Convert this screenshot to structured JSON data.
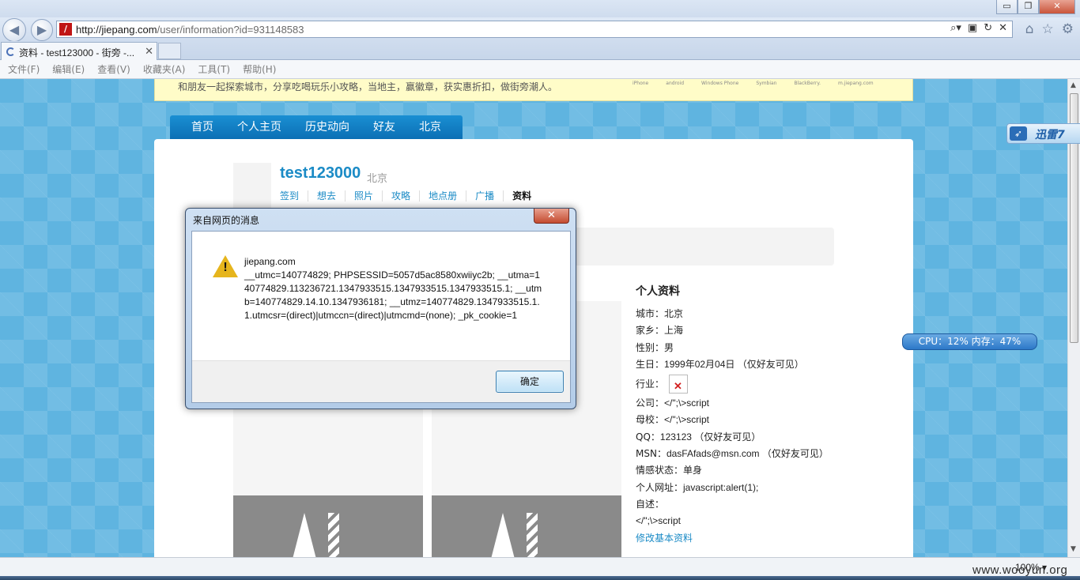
{
  "browser": {
    "url_host": "http://jiepang.com",
    "url_path": "/user/information?id=931148583",
    "tab_title": "资料 - test123000 - 街旁 -...",
    "tab_close": "✕",
    "menu": [
      "文件(F)",
      "编辑(E)",
      "查看(V)",
      "收藏夹(A)",
      "工具(T)",
      "帮助(H)"
    ],
    "zoom": "100%",
    "window_buttons": {
      "minimize": "▭",
      "maximize": "❐",
      "close": "✕"
    }
  },
  "page": {
    "notice_text": "和朋友一起探索城市，分享吃喝玩乐小攻略，当地主，赢徽章，获实惠折扣，做街旁潮人。",
    "platforms": [
      "iPhone",
      "android",
      "Windows Phone",
      "Symbian",
      "BlackBerry.",
      "m.jiepang.com"
    ],
    "nav": [
      "首页",
      "个人主页",
      "历史动向",
      "好友",
      "北京"
    ],
    "username": "test123000",
    "user_city": "北京",
    "subnav": [
      "签到",
      "想去",
      "照片",
      "攻略",
      "地点册",
      "广播",
      "资料"
    ],
    "subnav_active_index": 6,
    "profile_title": "个人资料",
    "profile_rows": [
      {
        "label": "城市：",
        "value": "北京"
      },
      {
        "label": "家乡：",
        "value": "上海"
      },
      {
        "label": "性别：",
        "value": "男"
      },
      {
        "label": "生日：",
        "value": "1999年02月04日 （仅好友可见）"
      }
    ],
    "industry_label": "行业：",
    "profile_rows2": [
      {
        "label": "公司：",
        "value": "</\";\\>script"
      },
      {
        "label": "母校：",
        "value": "</\";\\>script"
      },
      {
        "label": "QQ：",
        "value": "123123 （仅好友可见）"
      },
      {
        "label": "MSN：",
        "value": "dasFAfads@msn.com （仅好友可见）"
      },
      {
        "label": "情感状态：",
        "value": "单身"
      },
      {
        "label": "个人网址：",
        "value": "javascript:alert(1);"
      },
      {
        "label": "自述：",
        "value": ""
      }
    ],
    "self_desc": "</\";\\>script",
    "edit_link": "修改基本资料"
  },
  "dialog": {
    "title": "来自网页的消息",
    "close_label": "✕",
    "icon": "warning-icon",
    "icon_glyph": "!",
    "message_lines": [
      "jiepang.com",
      "__utmc=140774829; PHPSESSID=5057d5ac8580xwiiyc2b; __utma=140774829.113236721.1347933515.1347933515.1347933515.1; __utmb=140774829.14.10.1347936181; __utmz=140774829.1347933515.1.1.utmcsr=(direct)|utmccn=(direct)|utmcmd=(none); _pk_cookie=1"
    ],
    "ok_label": "确定"
  },
  "overlays": {
    "xunlei_label": "迅雷7",
    "cpu_text": "CPU：12%   内存：47%"
  },
  "watermark": "www.wooyun.org",
  "colors": {
    "accent": "#1b8bc6",
    "nav_blue": "#0b6fb5",
    "page_bg": "#5fb4e0",
    "notice_bg": "#fffcc8"
  }
}
